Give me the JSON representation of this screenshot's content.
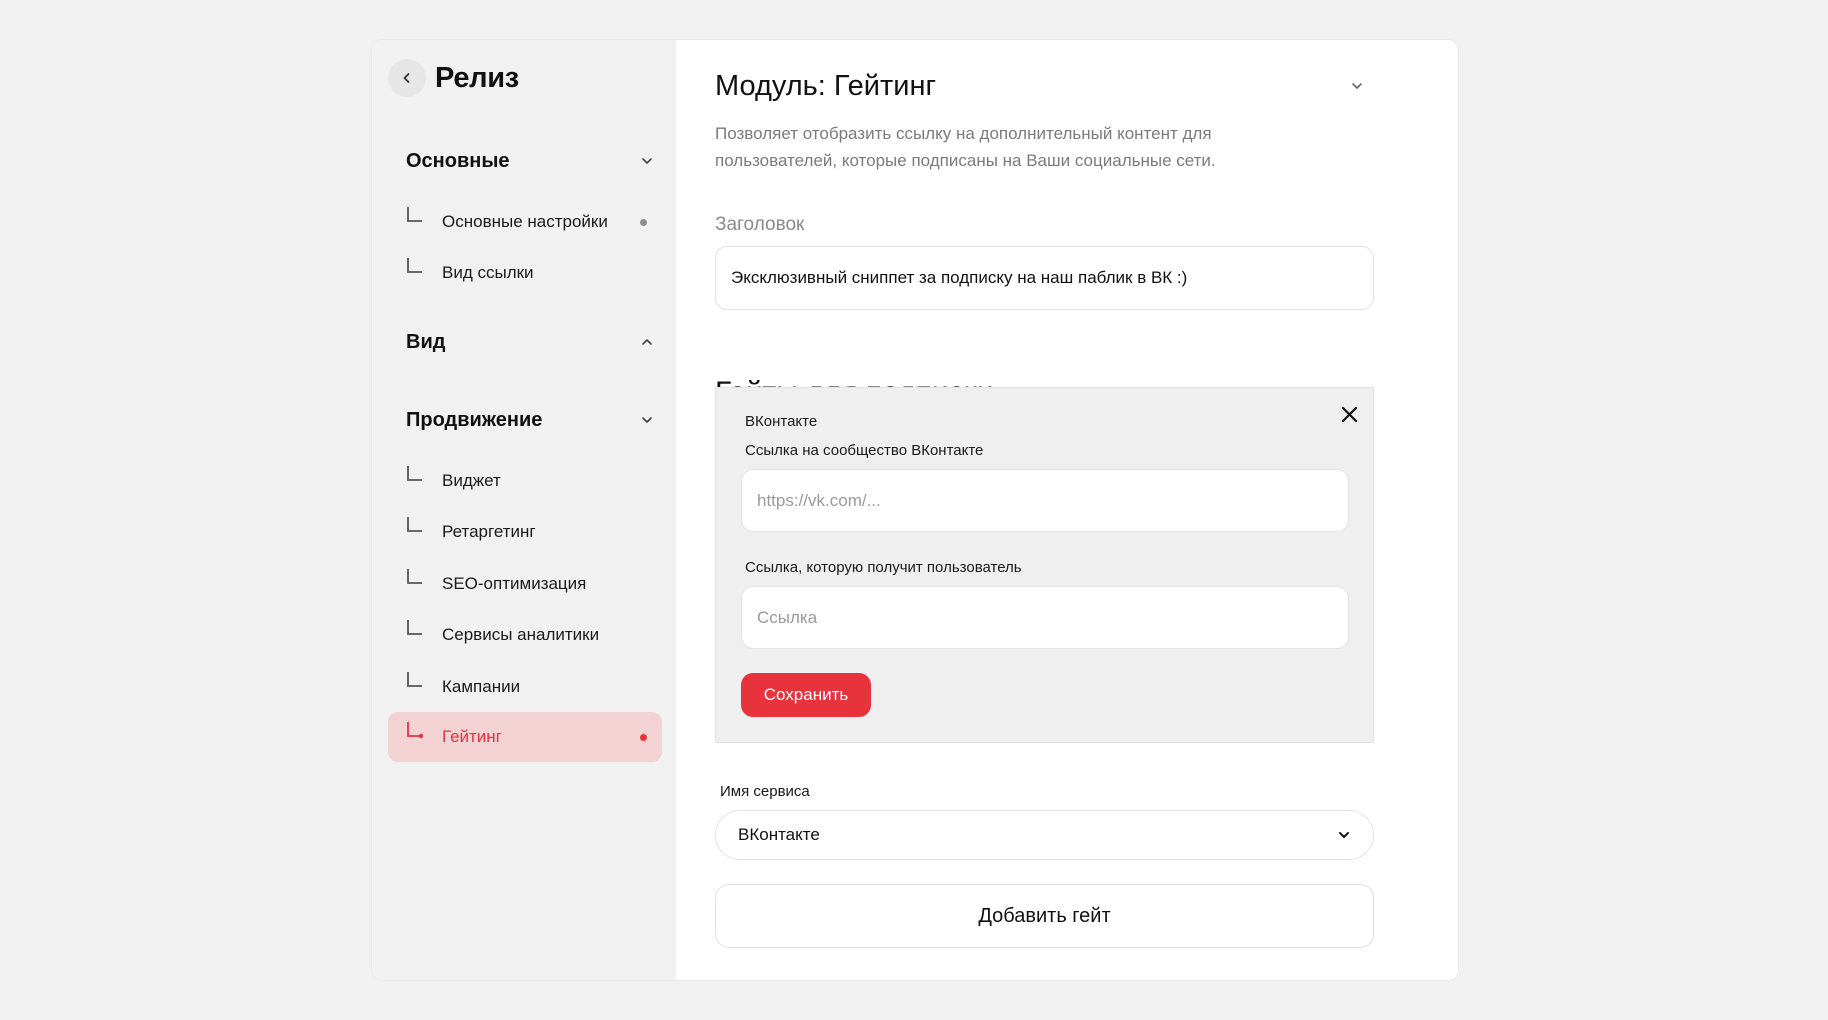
{
  "sidebar": {
    "title": "Релиз",
    "sections": [
      {
        "label": "Основные",
        "expanded": true,
        "items": [
          {
            "label": "Основные настройки",
            "has_dot": true
          },
          {
            "label": "Вид ссылки",
            "has_dot": false
          }
        ]
      },
      {
        "label": "Вид",
        "expanded": false,
        "items": []
      },
      {
        "label": "Продвижение",
        "expanded": true,
        "items": [
          {
            "label": "Виджет",
            "has_dot": false
          },
          {
            "label": "Ретаргетинг",
            "has_dot": false
          },
          {
            "label": "SEO-оптимизация",
            "has_dot": false
          },
          {
            "label": "Сервисы аналитики",
            "has_dot": false
          },
          {
            "label": "Кампании",
            "has_dot": false
          },
          {
            "label": "Гейтинг",
            "has_dot": true,
            "active": true
          }
        ]
      }
    ]
  },
  "main": {
    "title": "Модуль: Гейтинг",
    "description": "Позволяет отобразить ссылку на дополнительный контент для пользователей, которые подписаны на Ваши социальные сети.",
    "heading_field": {
      "label": "Заголовок",
      "value": "Эксклюзивный сниппет за подписку на наш паблик в ВК :)"
    },
    "gates_title": "Гейты для подписки",
    "gate_card": {
      "service_name": "ВКонтакте",
      "community_label": "Ссылка на сообщество ВКонтакте",
      "community_placeholder": "https://vk.com/...",
      "user_link_label": "Ссылка, которую получит пользователь",
      "user_link_placeholder": "Ссылка",
      "save_label": "Сохранить"
    },
    "service_select": {
      "label": "Имя сервиса",
      "value": "ВКонтакте"
    },
    "add_gate_label": "Добавить гейт"
  },
  "colors": {
    "accent": "#e8323c",
    "active_bg": "#f3d2d4",
    "sidebar_bg": "#f1f1f1",
    "page_bg": "#f1f1f1"
  }
}
